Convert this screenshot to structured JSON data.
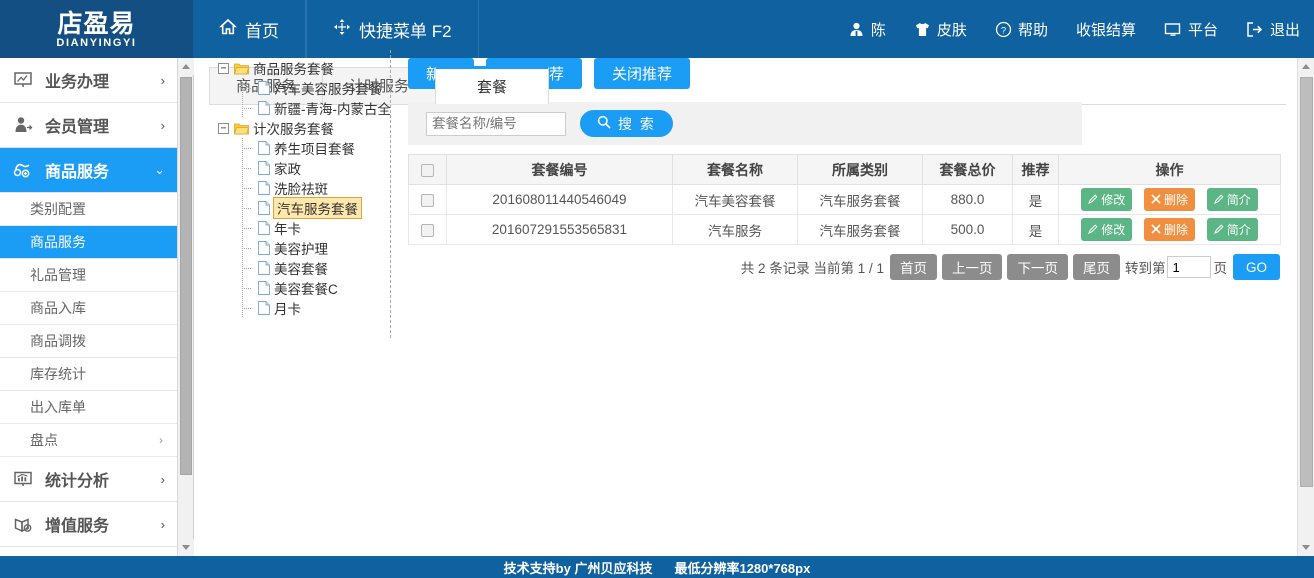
{
  "header": {
    "logo_cn": "店盈易",
    "logo_en": "DIANYINGYI",
    "nav_main": [
      {
        "label": "首页",
        "icon": "home-icon"
      },
      {
        "label": "快捷菜单 F2",
        "icon": "move-arrows-icon"
      }
    ],
    "nav_right": [
      {
        "label": "陈",
        "icon": "user-icon"
      },
      {
        "label": "皮肤",
        "icon": "tshirt-icon"
      },
      {
        "label": "帮助",
        "icon": "question-circle-icon"
      },
      {
        "label": "收银结算",
        "icon": ""
      },
      {
        "label": "平台",
        "icon": "monitor-icon"
      },
      {
        "label": "退出",
        "icon": "logout-icon"
      }
    ]
  },
  "sidebar": {
    "groups": [
      {
        "label": "业务办理",
        "icon": "presentation-icon",
        "chevron": "›",
        "active": false
      },
      {
        "label": "会员管理",
        "icon": "member-icon",
        "chevron": "›",
        "active": false
      },
      {
        "label": "商品服务",
        "icon": "tag-plus-icon",
        "chevron": "⌄",
        "active": true
      }
    ],
    "sub_items": [
      {
        "label": "类别配置",
        "active": false,
        "chevron": ""
      },
      {
        "label": "商品服务",
        "active": true,
        "chevron": ""
      },
      {
        "label": "礼品管理",
        "active": false,
        "chevron": ""
      },
      {
        "label": "商品入库",
        "active": false,
        "chevron": ""
      },
      {
        "label": "商品调拨",
        "active": false,
        "chevron": ""
      },
      {
        "label": "库存统计",
        "active": false,
        "chevron": ""
      },
      {
        "label": "出入库单",
        "active": false,
        "chevron": ""
      },
      {
        "label": "盘点",
        "active": false,
        "chevron": "›"
      }
    ],
    "groups_bottom": [
      {
        "label": "统计分析",
        "icon": "chart-monitor-icon",
        "chevron": "›",
        "active": false
      },
      {
        "label": "增值服务",
        "icon": "gift-plus-icon",
        "chevron": "›",
        "active": false
      }
    ]
  },
  "tabs": [
    {
      "label": "商品服务",
      "active": false
    },
    {
      "label": "计时服务",
      "active": false
    },
    {
      "label": "套餐",
      "active": true
    }
  ],
  "tree": [
    {
      "level": 0,
      "label": "商品服务套餐",
      "type": "folder",
      "toggle": "−",
      "selected": false
    },
    {
      "level": 1,
      "label": "汽车美容服务套餐",
      "type": "file",
      "toggle": "",
      "selected": false
    },
    {
      "level": 1,
      "label": "新疆-青海-内蒙古全家",
      "type": "file",
      "toggle": "",
      "selected": false
    },
    {
      "level": 0,
      "label": "计次服务套餐",
      "type": "folder",
      "toggle": "−",
      "selected": false
    },
    {
      "level": 1,
      "label": "养生项目套餐",
      "type": "file",
      "toggle": "",
      "selected": false
    },
    {
      "level": 1,
      "label": "家政",
      "type": "file",
      "toggle": "",
      "selected": false
    },
    {
      "level": 1,
      "label": "洗脸祛斑",
      "type": "file",
      "toggle": "",
      "selected": false
    },
    {
      "level": 1,
      "label": "汽车服务套餐",
      "type": "file",
      "toggle": "",
      "selected": true
    },
    {
      "level": 1,
      "label": "年卡",
      "type": "file",
      "toggle": "",
      "selected": false
    },
    {
      "level": 1,
      "label": "美容护理",
      "type": "file",
      "toggle": "",
      "selected": false
    },
    {
      "level": 1,
      "label": "美容套餐",
      "type": "file",
      "toggle": "",
      "selected": false
    },
    {
      "level": 1,
      "label": "美容套餐C",
      "type": "file",
      "toggle": "",
      "selected": false
    },
    {
      "level": 1,
      "label": "月卡",
      "type": "file",
      "toggle": "",
      "selected": false
    }
  ],
  "toolbar": {
    "add_label": "新增",
    "enable_recommend_label": "开启推荐",
    "disable_recommend_label": "关闭推荐"
  },
  "search": {
    "placeholder": "套餐名称/编号",
    "value": "",
    "button_label": "搜 索",
    "icon": "search-icon"
  },
  "table": {
    "columns": [
      "",
      "套餐编号",
      "套餐名称",
      "所属类别",
      "套餐总价",
      "推荐",
      "操作"
    ],
    "rows": [
      {
        "code": "201608011440546049",
        "name": "汽车美容套餐",
        "category": "汽车服务套餐",
        "price": "880.0",
        "recommend": "是"
      },
      {
        "code": "201607291553565831",
        "name": "汽车服务",
        "category": "汽车服务套餐",
        "price": "500.0",
        "recommend": "是"
      }
    ],
    "actions": {
      "edit": "修改",
      "delete": "删除",
      "intro": "简介"
    }
  },
  "pagination": {
    "summary": "共 2 条记录 当前第 1 / 1",
    "first": "首页",
    "prev": "上一页",
    "next": "下一页",
    "last": "尾页",
    "goto_prefix": "转到第",
    "goto_value": "1",
    "goto_suffix": "页",
    "go": "GO"
  },
  "footer": {
    "support": "技术支持by 广州贝应科技",
    "resolution": "最低分辨率1280*768px"
  },
  "colors": {
    "header_blue": "#0f619f",
    "logo_blue": "#134f82",
    "accent_blue": "#1b9cf5",
    "green": "#5cb585",
    "orange": "#ef8f3f",
    "gray_btn": "#8c8c8c"
  }
}
